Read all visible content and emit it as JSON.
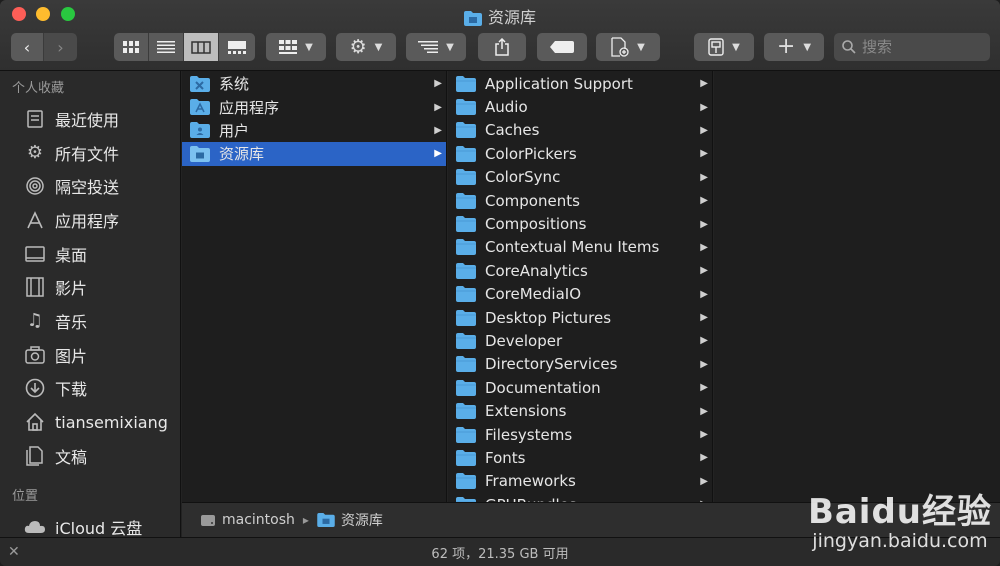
{
  "window": {
    "title": "资源库"
  },
  "toolbar": {
    "back_icon": "chevron-left",
    "forward_icon": "chevron-right",
    "view_modes": [
      "icons",
      "list",
      "columns",
      "gallery"
    ],
    "active_view": "columns",
    "search_placeholder": "搜索"
  },
  "sidebar": {
    "favorites_header": "个人收藏",
    "favorites": [
      {
        "label": "最近使用",
        "icon": "recents-icon"
      },
      {
        "label": "所有文件",
        "icon": "all-files-icon"
      },
      {
        "label": "隔空投送",
        "icon": "airdrop-icon"
      },
      {
        "label": "应用程序",
        "icon": "applications-icon"
      },
      {
        "label": "桌面",
        "icon": "desktop-icon"
      },
      {
        "label": "影片",
        "icon": "movies-icon"
      },
      {
        "label": "音乐",
        "icon": "music-icon"
      },
      {
        "label": "图片",
        "icon": "pictures-icon"
      },
      {
        "label": "下载",
        "icon": "downloads-icon"
      },
      {
        "label": "tiansemixiang",
        "icon": "home-icon"
      },
      {
        "label": "文稿",
        "icon": "documents-icon"
      }
    ],
    "locations_header": "位置",
    "locations": [
      {
        "label": "iCloud 云盘",
        "icon": "icloud-icon"
      }
    ]
  },
  "column1": [
    {
      "label": "系统",
      "selected": false
    },
    {
      "label": "应用程序",
      "selected": false
    },
    {
      "label": "用户",
      "selected": false
    },
    {
      "label": "资源库",
      "selected": true
    }
  ],
  "column2": [
    "Application Support",
    "Audio",
    "Caches",
    "ColorPickers",
    "ColorSync",
    "Components",
    "Compositions",
    "Contextual Menu Items",
    "CoreAnalytics",
    "CoreMediaIO",
    "Desktop Pictures",
    "Developer",
    "DirectoryServices",
    "Documentation",
    "Extensions",
    "Filesystems",
    "Fonts",
    "Frameworks",
    "GPUBundles"
  ],
  "pathbar": {
    "items": [
      "macintosh",
      "资源库"
    ]
  },
  "status": {
    "text": "62 项，21.35 GB 可用"
  },
  "watermark": {
    "logo": "Baidu经验",
    "url": "jingyan.baidu.com"
  },
  "colors": {
    "selection": "#2b64c6",
    "folder": "#5aaee8"
  }
}
